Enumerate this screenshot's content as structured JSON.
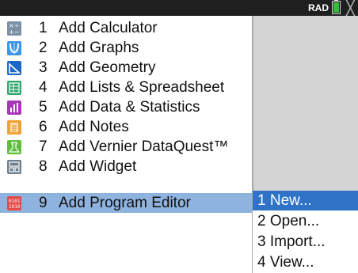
{
  "status_bar": {
    "angle_mode": "RAD",
    "battery_color": "#2fbf3a"
  },
  "menu": {
    "items": [
      {
        "num": "1",
        "label": "Add Calculator",
        "icon": "calculator-icon",
        "color": "#7c8fa5"
      },
      {
        "num": "2",
        "label": "Add Graphs",
        "icon": "graphs-icon",
        "color": "#3f96e6"
      },
      {
        "num": "3",
        "label": "Add Geometry",
        "icon": "geometry-icon",
        "color": "#1d67c7"
      },
      {
        "num": "4",
        "label": "Add Lists & Spreadsheet",
        "icon": "spreadsheet-icon",
        "color": "#2fa86b"
      },
      {
        "num": "5",
        "label": "Add Data & Statistics",
        "icon": "statistics-icon",
        "color": "#a737b8"
      },
      {
        "num": "6",
        "label": "Add Notes",
        "icon": "notes-icon",
        "color": "#f2a034"
      },
      {
        "num": "7",
        "label": "Add Vernier DataQuest™",
        "icon": "dataquest-icon",
        "color": "#5fbf3a"
      },
      {
        "num": "8",
        "label": "Add Widget",
        "icon": "widget-icon",
        "color": "#6f7f8f"
      },
      {
        "num": "9",
        "label": "Add Program Editor",
        "icon": "program-editor-icon",
        "color": "#e44a4a"
      }
    ],
    "selected_index": 8
  },
  "submenu": {
    "items": [
      {
        "num": "1",
        "label": "New..."
      },
      {
        "num": "2",
        "label": "Open..."
      },
      {
        "num": "3",
        "label": "Import..."
      },
      {
        "num": "4",
        "label": "View..."
      }
    ],
    "selected_index": 0
  },
  "colors": {
    "menu_highlight": "#8fb3df",
    "submenu_highlight": "#2f73c6"
  }
}
